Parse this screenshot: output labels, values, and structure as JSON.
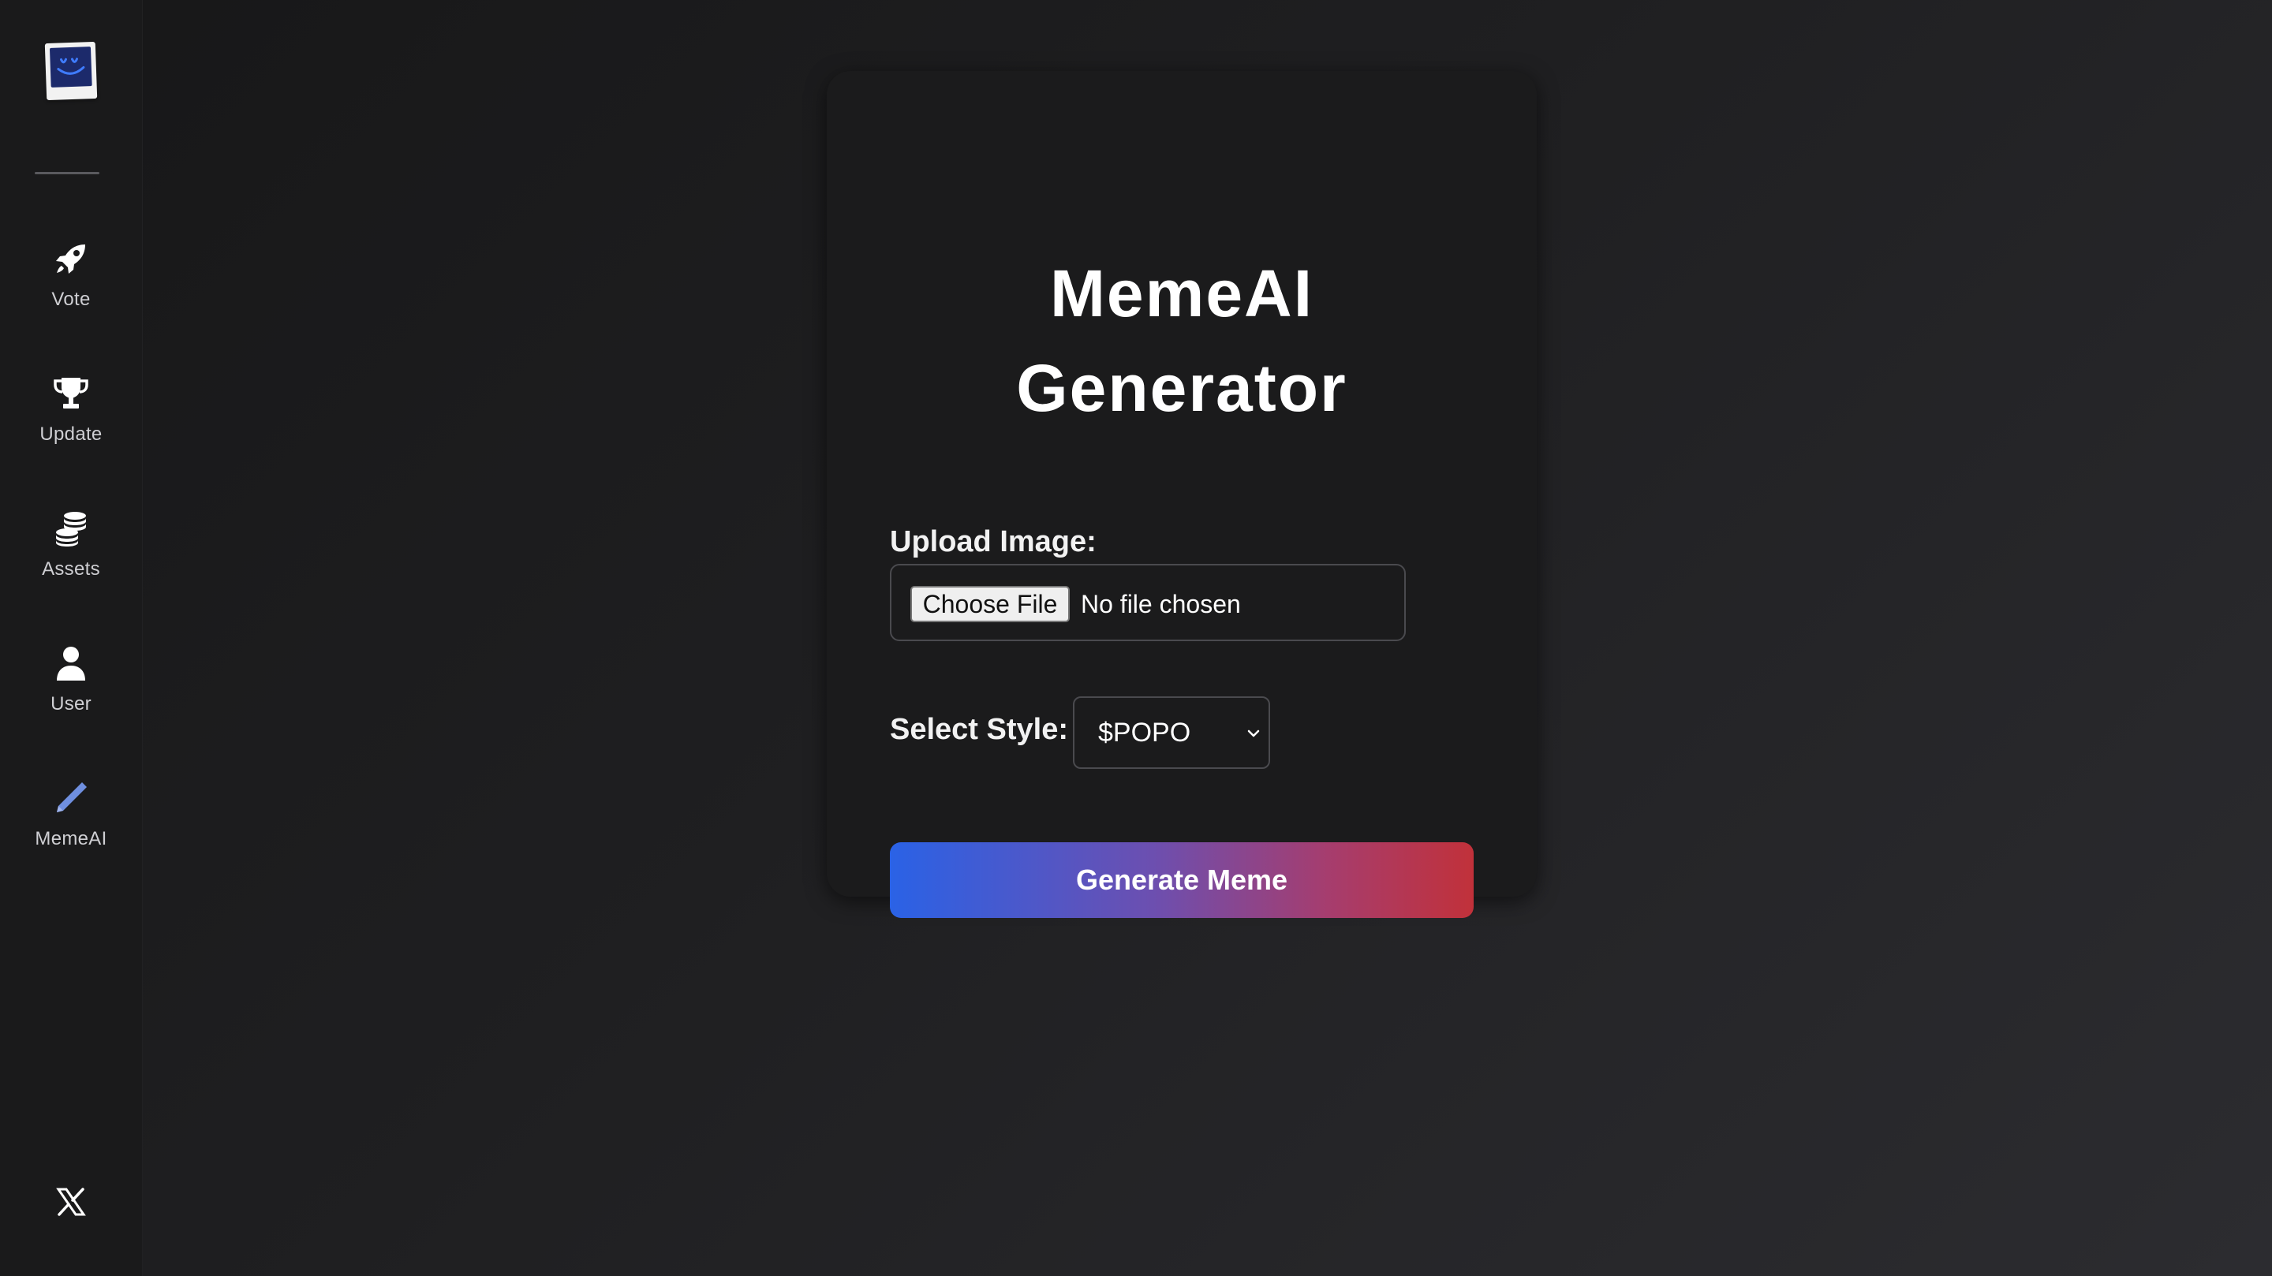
{
  "sidebar": {
    "logo": "logo",
    "items": [
      {
        "label": "Vote",
        "icon": "rocket-icon",
        "color": "#ffffff"
      },
      {
        "label": "Update",
        "icon": "trophy-icon",
        "color": "#ffffff"
      },
      {
        "label": "Assets",
        "icon": "coins-stack-icon",
        "color": "#ffffff"
      },
      {
        "label": "User",
        "icon": "user-icon",
        "color": "#ffffff"
      },
      {
        "label": "MemeAI",
        "icon": "pencil-icon",
        "color": "#6f8fe0",
        "active": true
      }
    ],
    "footer_icon": "x-logo-icon"
  },
  "card": {
    "title_line1": "MemeAI",
    "title_line2": "Generator",
    "upload_label": "Upload Image:",
    "file_button": "Choose File",
    "file_status": "No file chosen",
    "style_label": "Select Style:",
    "style_selected": "$POPO",
    "generate_label": "Generate Meme"
  },
  "colors": {
    "gradient_start": "#2a62e6",
    "gradient_end": "#c1313a",
    "card_bg": "#1b1b1c",
    "active_accent": "#6f8fe0"
  }
}
